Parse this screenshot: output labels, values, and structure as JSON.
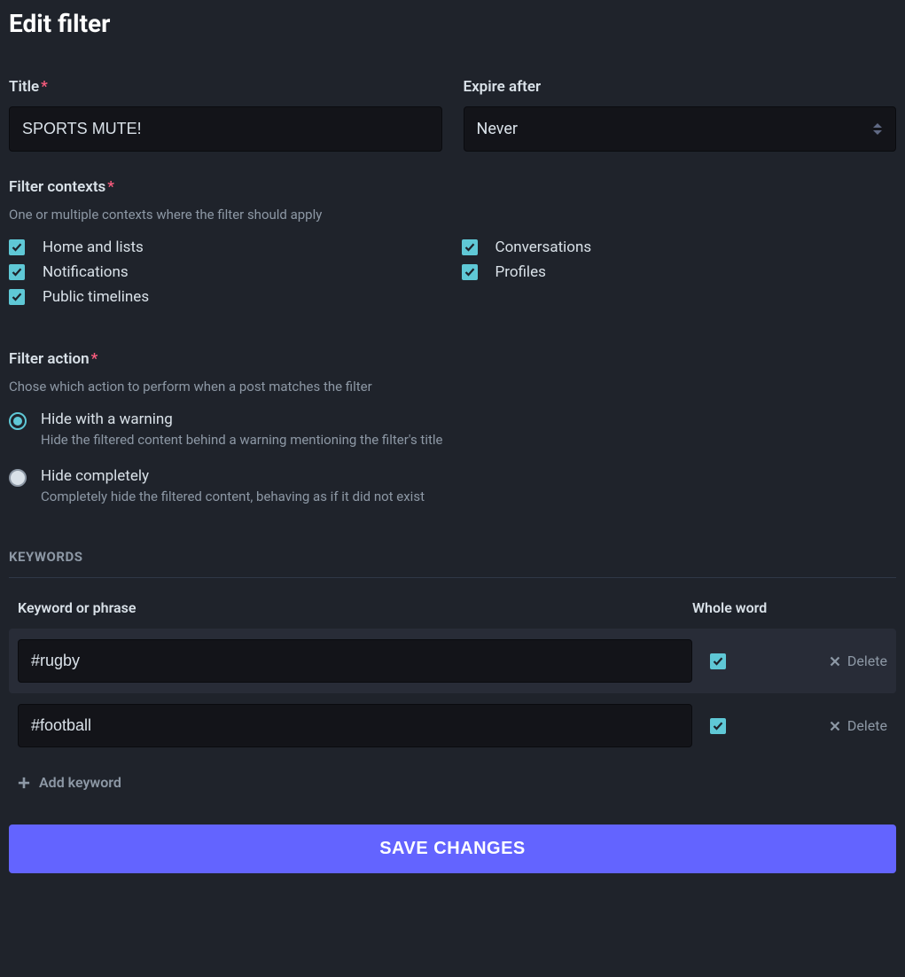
{
  "page": {
    "title": "Edit filter"
  },
  "form": {
    "title": {
      "label": "Title",
      "value": "SPORTS MUTE!"
    },
    "expire": {
      "label": "Expire after",
      "value": "Never"
    },
    "contexts": {
      "label": "Filter contexts",
      "hint": "One or multiple contexts where the filter should apply",
      "options": [
        {
          "label": "Home and lists",
          "checked": true
        },
        {
          "label": "Conversations",
          "checked": true
        },
        {
          "label": "Notifications",
          "checked": true
        },
        {
          "label": "Profiles",
          "checked": true
        },
        {
          "label": "Public timelines",
          "checked": true
        }
      ]
    },
    "action": {
      "label": "Filter action",
      "hint": "Chose which action to perform when a post matches the filter",
      "options": [
        {
          "label": "Hide with a warning",
          "hint": "Hide the filtered content behind a warning mentioning the filter's title",
          "selected": true
        },
        {
          "label": "Hide completely",
          "hint": "Completely hide the filtered content, behaving as if it did not exist",
          "selected": false
        }
      ]
    }
  },
  "keywords": {
    "heading": "KEYWORDS",
    "columns": {
      "keyword": "Keyword or phrase",
      "whole": "Whole word"
    },
    "rows": [
      {
        "value": "#rugby",
        "whole": true
      },
      {
        "value": "#football",
        "whole": true
      }
    ],
    "delete_label": "Delete",
    "add_label": "Add keyword"
  },
  "submit": {
    "label": "SAVE CHANGES"
  }
}
